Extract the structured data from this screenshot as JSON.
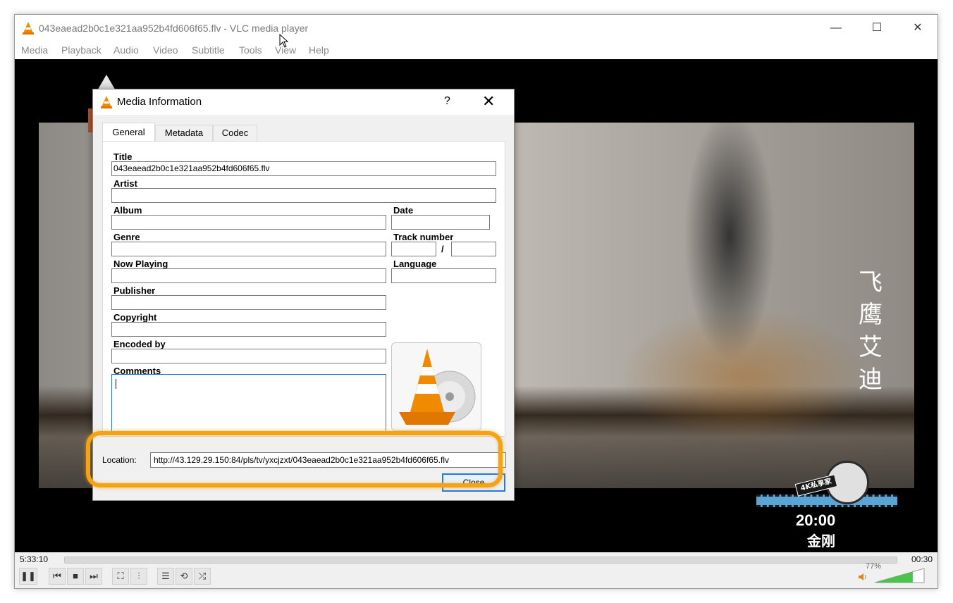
{
  "window": {
    "title": "043eaead2b0c1e321aa952b4fd606f65.flv - VLC media player",
    "controls": {
      "minimize": "—",
      "maximize": "☐",
      "close": "✕"
    }
  },
  "menubar": [
    "Media",
    "Playback",
    "Audio",
    "Video",
    "Subtitle",
    "Tools",
    "View",
    "Help"
  ],
  "video": {
    "overlay_vertical_text": [
      "飞",
      "鹰",
      "艾",
      "迪"
    ],
    "badge": {
      "tag": "4K私享家",
      "time": "20:00",
      "name": "金刚"
    }
  },
  "player": {
    "elapsed": "5:33:10",
    "remaining": "00:30",
    "volume": "77%",
    "volume_level": 0.77,
    "buttons": {
      "pause": "❚❚",
      "prev": "⏮",
      "stop": "■",
      "next": "⏭",
      "fullscreen": "⛶",
      "ext": "⫶",
      "playlist": "☰",
      "loop": "⟲",
      "shuffle": "⤮"
    }
  },
  "dialog": {
    "title": "Media Information",
    "help": "?",
    "close_x": "✕",
    "tabs": [
      "General",
      "Metadata",
      "Codec"
    ],
    "labels": {
      "title": "Title",
      "artist": "Artist",
      "album": "Album",
      "date": "Date",
      "genre": "Genre",
      "track_number": "Track number",
      "now_playing": "Now Playing",
      "language": "Language",
      "publisher": "Publisher",
      "copyright": "Copyright",
      "encoded_by": "Encoded by",
      "comments": "Comments"
    },
    "values": {
      "title": "043eaead2b0c1e321aa952b4fd606f65.flv",
      "artist": "",
      "album": "",
      "date": "",
      "genre": "",
      "track": "",
      "track_total": "",
      "track_sep": "/",
      "now_playing": "",
      "language": "",
      "publisher": "",
      "copyright": "",
      "encoded_by": "",
      "comments": ""
    },
    "location_label": "Location:",
    "location": "http://43.129.29.150:84/pls/tv/yxcjzxt/043eaead2b0c1e321aa952b4fd606f65.flv",
    "close_button": "Close"
  },
  "colors": {
    "highlight": "#f5a214",
    "vlc_orange": "#f08a00",
    "focus_blue": "#2a78d6"
  }
}
